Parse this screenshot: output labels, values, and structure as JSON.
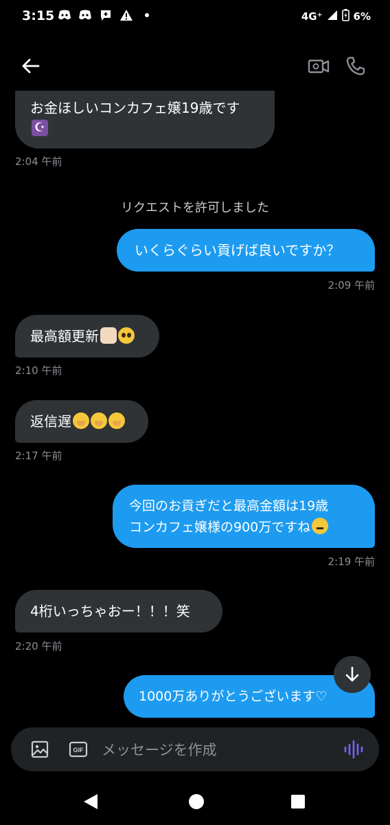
{
  "status": {
    "time": "3:15",
    "network": "4G⁺",
    "battery": "6%"
  },
  "composer": {
    "placeholder": "メッセージを作成",
    "gif_label": "GIF"
  },
  "messages": [
    {
      "text": "お金ほしいコンカフェ嬢19歳です",
      "emoji": "star-and-crescent-emoji",
      "time": "2:04 午前"
    },
    {
      "system": "リクエストを許可しました"
    },
    {
      "text": "いくらぐらい貢げば良いですか？",
      "time": "2:09 午前"
    },
    {
      "text": "最高額更新",
      "emoji": [
        "raised-fist-emoji",
        "pleading-face-emoji"
      ],
      "time": "2:10 午前"
    },
    {
      "text": "返信遅",
      "emoji": [
        "giggle-face-emoji",
        "giggle-face-emoji",
        "giggle-face-emoji"
      ],
      "time": "2:17 午前"
    },
    {
      "line1": "今回のお貢ぎだと最高金額は19歳",
      "line2": "コンカフェ嬢様の900万ですね",
      "emoji": "thinking-face-emoji",
      "time": "2:19 午前"
    },
    {
      "text": "4桁いっちゃおー！！！笑",
      "time": "2:20 午前"
    },
    {
      "text": "1000万ありがとうございます♡"
    }
  ],
  "colors": {
    "sent": "#1d9bf0",
    "received": "#2f3336",
    "background": "#000000",
    "timestamp": "#8b9096",
    "voice_accent": "#7b61ff"
  }
}
